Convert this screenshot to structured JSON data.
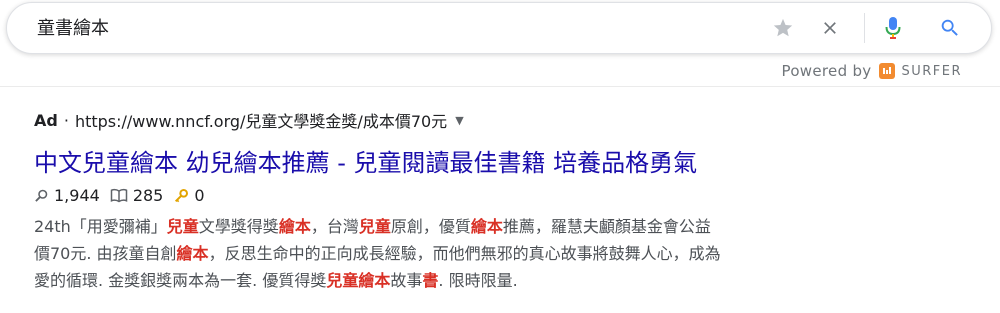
{
  "search": {
    "query": "童書繪本"
  },
  "powered_by": {
    "label": "Powered by",
    "brand": "SURFER"
  },
  "ad": {
    "label": "Ad",
    "separator": "·",
    "url": "https://www.nncf.org/兒童文學獎金獎/成本價70元",
    "dropdown_icon": "caret-down-icon",
    "title": "中文兒童繪本 幼兒繪本推薦 - 兒童閱讀最佳書籍 培養品格勇氣",
    "stats": {
      "searches": "1,944",
      "reads": "285",
      "keys": "0"
    },
    "snippet_segments": [
      {
        "t": "24th「用愛彌補」",
        "h": false
      },
      {
        "t": "兒童",
        "h": true
      },
      {
        "t": "文學獎得獎",
        "h": false
      },
      {
        "t": "繪本",
        "h": true
      },
      {
        "t": "，台灣",
        "h": false
      },
      {
        "t": "兒童",
        "h": true
      },
      {
        "t": "原創，優質",
        "h": false
      },
      {
        "t": "繪本",
        "h": true
      },
      {
        "t": "推薦，羅慧夫顱顏基金會公益",
        "h": false
      },
      {
        "t": "\n",
        "h": false
      },
      {
        "t": "價70元. 由孩童自創",
        "h": false
      },
      {
        "t": "繪本",
        "h": true
      },
      {
        "t": "，反思生命中的正向成長經驗，而他們無邪的真心故事將鼓舞人心，成為",
        "h": false
      },
      {
        "t": "\n",
        "h": false
      },
      {
        "t": "愛的循環. 金獎銀獎兩本為一套. 優質得獎",
        "h": false
      },
      {
        "t": "兒童繪本",
        "h": true
      },
      {
        "t": "故事",
        "h": false
      },
      {
        "t": "書",
        "h": true
      },
      {
        "t": ". 限時限量.",
        "h": false
      }
    ]
  },
  "colors": {
    "link": "#1a0dab",
    "highlight": "#d93025",
    "surfer_brand": "#f28b30",
    "search_icon": "#4285f4"
  }
}
